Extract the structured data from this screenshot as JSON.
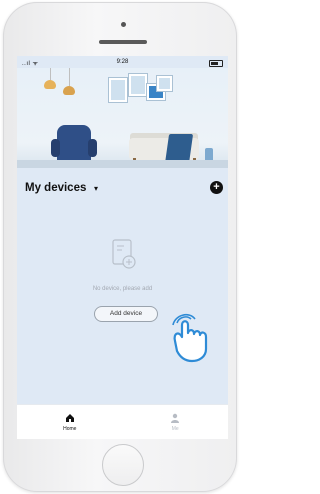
{
  "status_bar": {
    "signal": "..ıl ᯤ",
    "time": "9:28"
  },
  "header": {
    "title": "My devices",
    "dropdown_icon": "chevron-down-icon",
    "add_icon": "plus-icon"
  },
  "empty_state": {
    "message": "No device, please add",
    "button_label": "Add device"
  },
  "tabs": [
    {
      "label": "Home",
      "icon": "home-icon",
      "active": true
    },
    {
      "label": "Me",
      "icon": "person-icon",
      "active": false
    }
  ],
  "colors": {
    "screen_bg": "#dfe9f5",
    "active_tab": "#111111",
    "inactive_tab": "#b7bcc4",
    "accent_blue": "#3a84c6"
  }
}
